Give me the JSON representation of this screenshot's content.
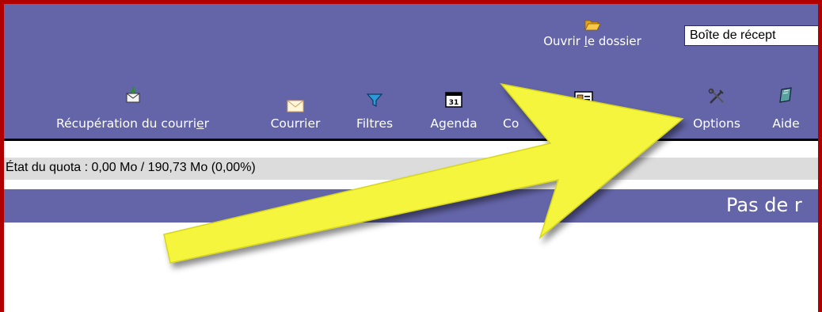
{
  "toolbar": {
    "open_folder_prefix": "Ouvrir ",
    "open_folder_underlined": "l",
    "open_folder_suffix": "e dossier",
    "mailbox_selected": "Boîte de récept"
  },
  "nav": {
    "fetch_mail_prefix": "Récupération du courri",
    "fetch_mail_underlined": "e",
    "fetch_mail_suffix": "r",
    "mail": "Courrier",
    "filters": "Filtres",
    "calendar": "Agenda",
    "contacts_partial": "Co",
    "options": "Options",
    "help": "Aide",
    "calendar_icon_number": "31"
  },
  "quota": {
    "text": "État du quota : 0,00 Mo / 190,73 Mo (0,00%)"
  },
  "list_header": {
    "title": "Pas de r"
  },
  "colors": {
    "bar_background": "#6465a9",
    "frame_border": "#b00000",
    "quota_background": "#dcdcdc",
    "arrow_fill": "#f5f53c"
  },
  "icons": [
    "folder-open-icon",
    "fetch-mail-icon",
    "envelope-icon",
    "filter-funnel-icon",
    "calendar-icon",
    "address-card-icon",
    "tools-icon",
    "help-book-icon",
    "arrow-annotation"
  ]
}
